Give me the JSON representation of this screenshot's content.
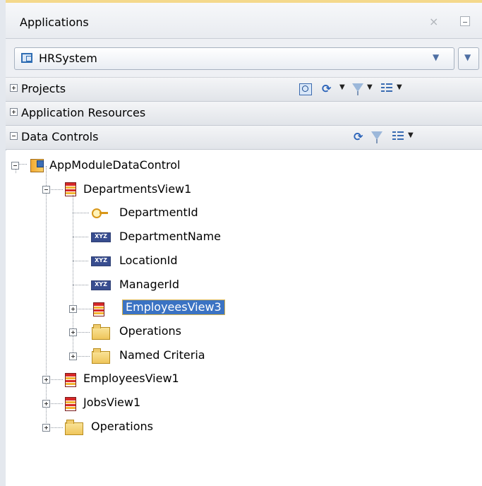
{
  "panel": {
    "title": "Applications",
    "close_glyph": "×"
  },
  "application_selector": {
    "value": "HRSystem",
    "icon": "application-icon"
  },
  "sections": {
    "projects": "Projects",
    "application_resources": "Application Resources",
    "data_controls": "Data Controls"
  },
  "icons": {
    "search": "search-icon",
    "refresh": "refresh-icon",
    "filter": "filter-icon",
    "list": "list-icon"
  },
  "tree": {
    "root": "AppModuleDataControl",
    "departments_view": "DepartmentsView1",
    "department_id": "DepartmentId",
    "department_name": "DepartmentName",
    "location_id": "LocationId",
    "manager_id": "ManagerId",
    "employees_view3": "EmployeesView3",
    "operations": "Operations",
    "named_criteria": "Named Criteria",
    "employees_view1": "EmployeesView1",
    "jobs_view1": "JobsView1",
    "root_operations": "Operations"
  },
  "colors": {
    "selection": "#3b73c3",
    "selection_border": "#d9b34e"
  }
}
